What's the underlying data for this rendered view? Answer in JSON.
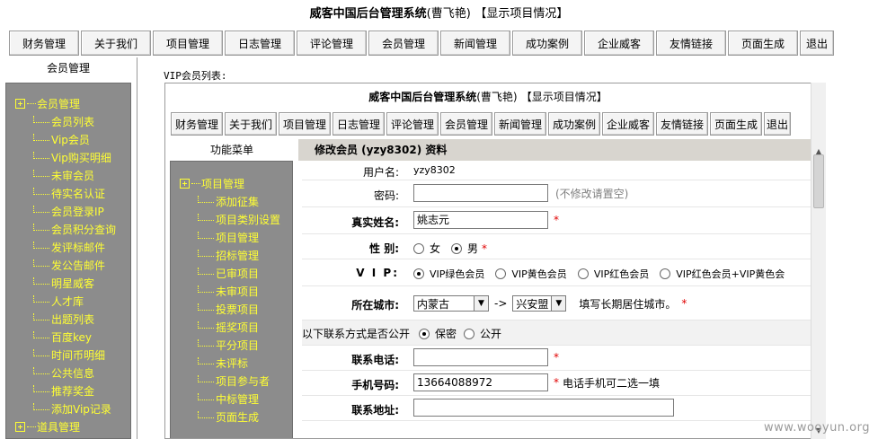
{
  "title": {
    "main": "威客中国后台管理系统",
    "user": "(曹飞艳)",
    "link": "【显示项目情况】"
  },
  "nav": [
    "财务管理",
    "关于我们",
    "项目管理",
    "日志管理",
    "评论管理",
    "会员管理",
    "新闻管理",
    "成功案例",
    "企业威客",
    "友情链接",
    "页面生成",
    "退出"
  ],
  "left_panel": {
    "heading": "会员管理",
    "root1": "会员管理",
    "items": [
      "会员列表",
      "Vip会员",
      "Vip购买明细",
      "未审会员",
      "待实名认证",
      "会员登录IP",
      "会员积分查询",
      "发评标邮件",
      "发公告邮件",
      "明星威客",
      "人才库",
      "出题列表",
      "百度key",
      "时间币明细",
      "公共信息",
      "推荐奖金",
      "添加Vip记录"
    ],
    "root2": "道具管理"
  },
  "vip_list_label": "VIP会员列表:",
  "inner": {
    "title": {
      "main": "威客中国后台管理系统",
      "user": "(曹飞艳)",
      "link": "【显示项目情况】"
    },
    "func_heading": "功能菜单",
    "func_root": "项目管理",
    "func_items": [
      "添加征集",
      "项目类别设置",
      "项目管理",
      "招标管理",
      "已审项目",
      "未审项目",
      "投票项目",
      "摇奖项目",
      "平分项目",
      "未评标",
      "项目参与者",
      "中标管理",
      "页面生成"
    ],
    "form": {
      "heading": "修改会员 (yzy8302) 资料",
      "username_label": "用户名:",
      "username_value": "yzy8302",
      "password_label": "密码:",
      "password_hint": "(不修改请置空)",
      "realname_label": "真实姓名:",
      "realname_value": "姚志元",
      "gender_label": "性  别:",
      "gender_female": "女",
      "gender_male": "男",
      "vip_label": "V I P:",
      "vip_options": [
        "VIP绿色会员",
        "VIP黄色会员",
        "VIP红色会员",
        "VIP红色会员+VIP黄色会"
      ],
      "city_label": "所在城市:",
      "province": "内蒙古",
      "arrow": "->",
      "city": "兴安盟",
      "city_hint": "填写长期居住城市。",
      "contact_public": "以下联系方式是否公开",
      "secret": "保密",
      "public": "公开",
      "phone_label": "联系电话:",
      "mobile_label": "手机号码:",
      "mobile_value": "13664088972",
      "mobile_hint": "电话手机可二选一填",
      "address_label": "联系地址:",
      "required_mark": "*"
    }
  },
  "watermark": "www.wooyun.org"
}
